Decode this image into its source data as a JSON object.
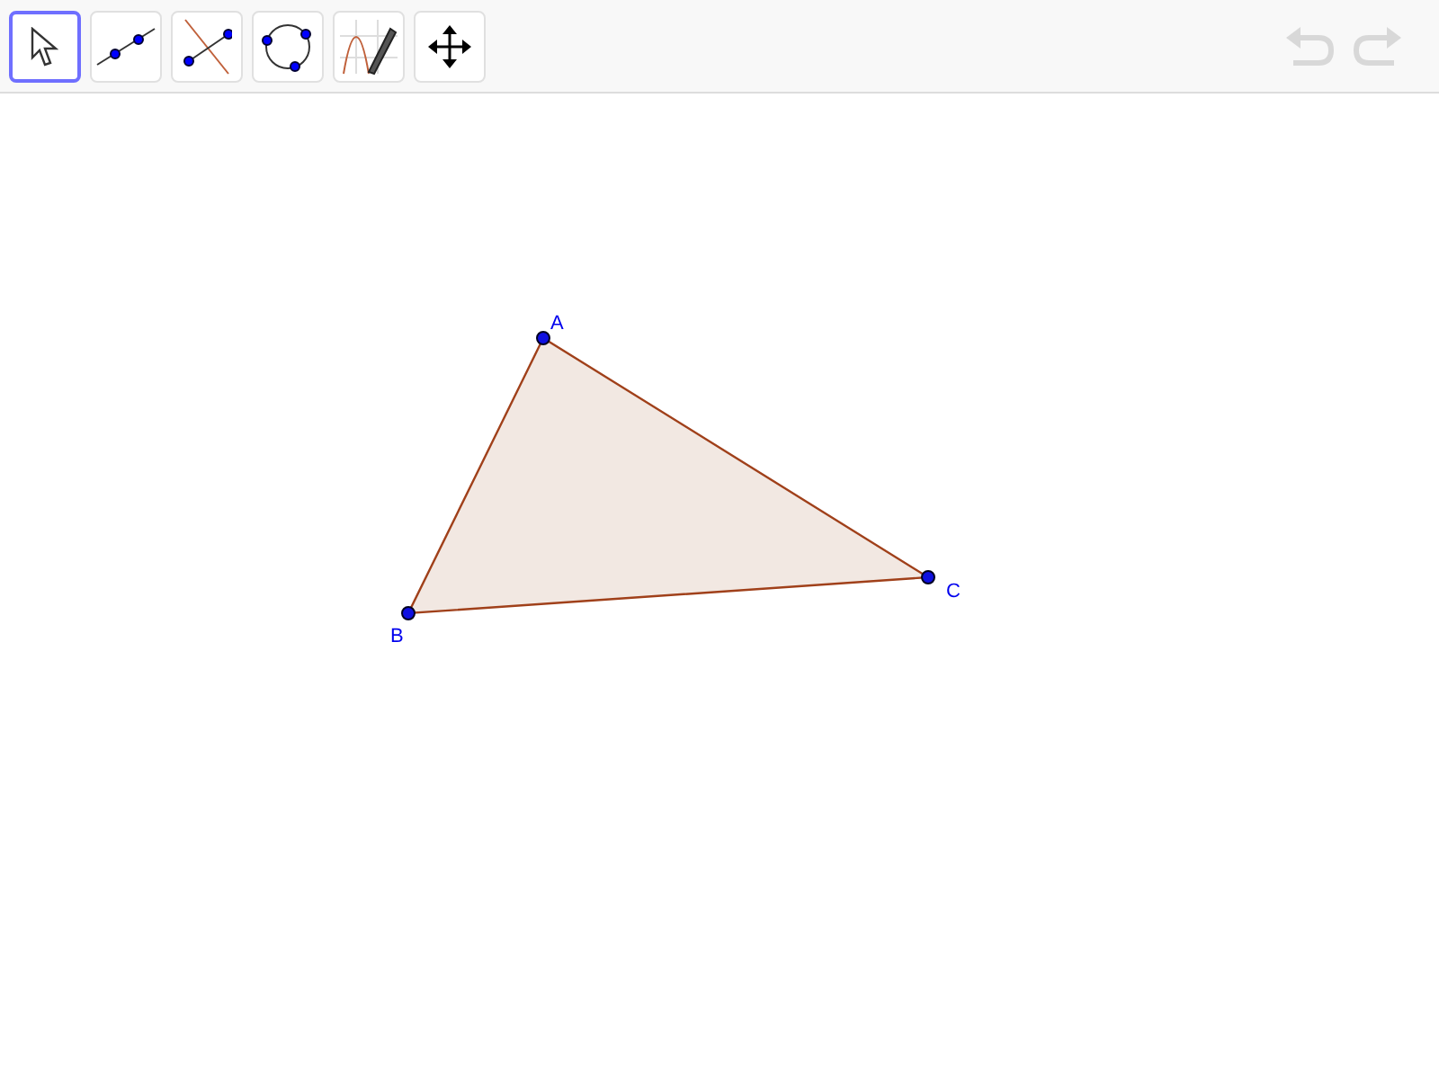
{
  "toolbar": {
    "tools": [
      {
        "kind": "pointer",
        "selected": true
      },
      {
        "kind": "line",
        "selected": false
      },
      {
        "kind": "perpendicular",
        "selected": false
      },
      {
        "kind": "circle",
        "selected": false
      },
      {
        "kind": "function",
        "selected": false
      },
      {
        "kind": "move",
        "selected": false
      }
    ],
    "undo": {
      "disabled": true
    },
    "redo": {
      "disabled": true
    }
  },
  "canvas": {
    "points": [
      {
        "label": "A"
      },
      {
        "label": "B"
      },
      {
        "label": "C"
      }
    ]
  }
}
